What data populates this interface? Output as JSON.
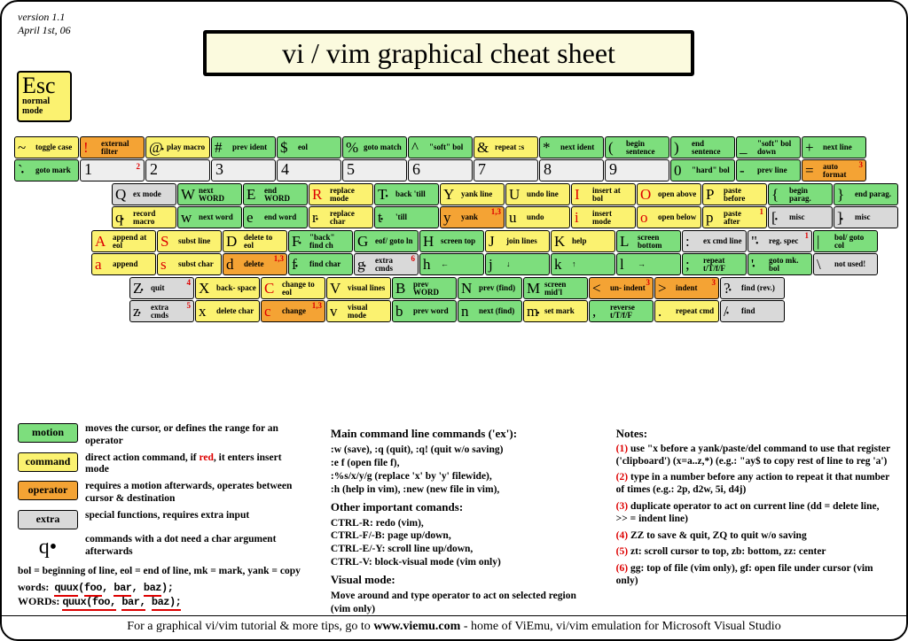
{
  "meta": {
    "version": "version 1.1",
    "date": "April 1st, 06"
  },
  "title": "vi / vim graphical cheat sheet",
  "esc": {
    "label": "Esc",
    "sub": "normal mode"
  },
  "rows": [
    [
      {
        "g": "~",
        "l": "toggle case",
        "c": "command"
      },
      {
        "g": "!",
        "l": "external filter",
        "c": "operator",
        "red": true
      },
      {
        "g": "@",
        "l": "play macro",
        "c": "command",
        "dot": true
      },
      {
        "g": "#",
        "l": "prev ident",
        "c": "motion"
      },
      {
        "g": "$",
        "l": "eol",
        "c": "motion"
      },
      {
        "g": "%",
        "l": "goto match",
        "c": "motion"
      },
      {
        "g": "^",
        "l": "\"soft\" bol",
        "c": "motion"
      },
      {
        "g": "&",
        "l": "repeat :s",
        "c": "command"
      },
      {
        "g": "*",
        "l": "next ident",
        "c": "motion"
      },
      {
        "g": "(",
        "l": "begin sentence",
        "c": "motion"
      },
      {
        "g": ")",
        "l": "end sentence",
        "c": "motion"
      },
      {
        "g": "_",
        "l": "\"soft\" bol down",
        "c": "motion"
      },
      {
        "g": "+",
        "l": "next line",
        "c": "motion"
      }
    ],
    [
      {
        "g": "`",
        "l": "goto mark",
        "c": "motion",
        "dot": true
      },
      {
        "g": "1",
        "c": "num",
        "sup": "2"
      },
      {
        "g": "2",
        "c": "num"
      },
      {
        "g": "3",
        "c": "num"
      },
      {
        "g": "4",
        "c": "num"
      },
      {
        "g": "5",
        "c": "num"
      },
      {
        "g": "6",
        "c": "num"
      },
      {
        "g": "7",
        "c": "num"
      },
      {
        "g": "8",
        "c": "num"
      },
      {
        "g": "9",
        "c": "num"
      },
      {
        "g": "0",
        "l": "\"hard\" bol",
        "c": "motion"
      },
      {
        "g": "-",
        "l": "prev line",
        "c": "motion"
      },
      {
        "g": "=",
        "l": "auto format",
        "c": "operator",
        "sup": "3"
      }
    ],
    [
      {
        "g": "Q",
        "l": "ex mode",
        "c": "extra"
      },
      {
        "g": "W",
        "l": "next WORD",
        "c": "motion"
      },
      {
        "g": "E",
        "l": "end WORD",
        "c": "motion"
      },
      {
        "g": "R",
        "l": "replace mode",
        "c": "command",
        "red": true
      },
      {
        "g": "T",
        "l": "back 'till",
        "c": "motion",
        "dot": true
      },
      {
        "g": "Y",
        "l": "yank line",
        "c": "command"
      },
      {
        "g": "U",
        "l": "undo line",
        "c": "command"
      },
      {
        "g": "I",
        "l": "insert at bol",
        "c": "command",
        "red": true
      },
      {
        "g": "O",
        "l": "open above",
        "c": "command",
        "red": true
      },
      {
        "g": "P",
        "l": "paste before",
        "c": "command"
      },
      {
        "g": "{",
        "l": "begin parag.",
        "c": "motion"
      },
      {
        "g": "}",
        "l": "end parag.",
        "c": "motion"
      }
    ],
    [
      {
        "g": "q",
        "l": "record macro",
        "c": "command",
        "dot": true
      },
      {
        "g": "w",
        "l": "next word",
        "c": "motion"
      },
      {
        "g": "e",
        "l": "end word",
        "c": "motion"
      },
      {
        "g": "r",
        "l": "replace char",
        "c": "command",
        "dot": true
      },
      {
        "g": "t",
        "l": "'till",
        "c": "motion",
        "dot": true
      },
      {
        "g": "y",
        "l": "yank",
        "c": "operator",
        "sup": "1,3"
      },
      {
        "g": "u",
        "l": "undo",
        "c": "command"
      },
      {
        "g": "i",
        "l": "insert mode",
        "c": "command",
        "red": true
      },
      {
        "g": "o",
        "l": "open below",
        "c": "command",
        "red": true
      },
      {
        "g": "p",
        "l": "paste after",
        "c": "command",
        "sup": "1"
      },
      {
        "g": "[",
        "l": "misc",
        "c": "extra",
        "dot": true
      },
      {
        "g": "]",
        "l": "misc",
        "c": "extra",
        "dot": true
      }
    ],
    [
      {
        "g": "A",
        "l": "append at eol",
        "c": "command",
        "red": true
      },
      {
        "g": "S",
        "l": "subst line",
        "c": "command",
        "red": true
      },
      {
        "g": "D",
        "l": "delete to eol",
        "c": "command"
      },
      {
        "g": "F",
        "l": "\"back\" find ch",
        "c": "motion",
        "dot": true
      },
      {
        "g": "G",
        "l": "eof/ goto ln",
        "c": "motion"
      },
      {
        "g": "H",
        "l": "screen top",
        "c": "motion"
      },
      {
        "g": "J",
        "l": "join lines",
        "c": "command"
      },
      {
        "g": "K",
        "l": "help",
        "c": "command"
      },
      {
        "g": "L",
        "l": "screen bottom",
        "c": "motion"
      },
      {
        "g": ":",
        "l": "ex cmd line",
        "c": "extra"
      },
      {
        "g": "\"",
        "l": "reg. spec",
        "c": "extra",
        "dot": true,
        "sup": "1"
      },
      {
        "g": "|",
        "l": "bol/ goto col",
        "c": "motion"
      }
    ],
    [
      {
        "g": "a",
        "l": "append",
        "c": "command",
        "red": true
      },
      {
        "g": "s",
        "l": "subst char",
        "c": "command",
        "red": true
      },
      {
        "g": "d",
        "l": "delete",
        "c": "operator",
        "sup": "1,3"
      },
      {
        "g": "f",
        "l": "find char",
        "c": "motion",
        "dot": true
      },
      {
        "g": "g",
        "l": "extra cmds",
        "c": "extra",
        "dot": true,
        "sup": "6"
      },
      {
        "g": "h",
        "l": "←",
        "c": "motion",
        "arr": true
      },
      {
        "g": "j",
        "l": "↓",
        "c": "motion",
        "arr": true
      },
      {
        "g": "k",
        "l": "↑",
        "c": "motion",
        "arr": true
      },
      {
        "g": "l",
        "l": "→",
        "c": "motion",
        "arr": true
      },
      {
        "g": ";",
        "l": "repeat t/T/f/F",
        "c": "motion"
      },
      {
        "g": "'",
        "l": "goto mk. bol",
        "c": "motion",
        "dot": true
      },
      {
        "g": "\\",
        "l": "not used!",
        "c": "extra"
      }
    ],
    [
      {
        "g": "Z",
        "l": "quit",
        "c": "extra",
        "dot": true,
        "sup": "4"
      },
      {
        "g": "X",
        "l": "back- space",
        "c": "command"
      },
      {
        "g": "C",
        "l": "change to eol",
        "c": "command",
        "red": true
      },
      {
        "g": "V",
        "l": "visual lines",
        "c": "command"
      },
      {
        "g": "B",
        "l": "prev WORD",
        "c": "motion"
      },
      {
        "g": "N",
        "l": "prev (find)",
        "c": "motion"
      },
      {
        "g": "M",
        "l": "screen mid'l",
        "c": "motion"
      },
      {
        "g": "<",
        "l": "un- indent",
        "c": "operator",
        "sup": "3"
      },
      {
        "g": ">",
        "l": "indent",
        "c": "operator",
        "sup": "3"
      },
      {
        "g": "?",
        "l": "find (rev.)",
        "c": "extra",
        "dot": true
      }
    ],
    [
      {
        "g": "z",
        "l": "extra cmds",
        "c": "extra",
        "dot": true,
        "sup": "5"
      },
      {
        "g": "x",
        "l": "delete char",
        "c": "command"
      },
      {
        "g": "c",
        "l": "change",
        "c": "operator",
        "red": true,
        "sup": "1,3"
      },
      {
        "g": "v",
        "l": "visual mode",
        "c": "command"
      },
      {
        "g": "b",
        "l": "prev word",
        "c": "motion"
      },
      {
        "g": "n",
        "l": "next (find)",
        "c": "motion"
      },
      {
        "g": "m",
        "l": "set mark",
        "c": "command",
        "dot": true
      },
      {
        "g": ",",
        "l": "reverse t/T/f/F",
        "c": "motion"
      },
      {
        "g": ".",
        "l": "repeat cmd",
        "c": "command"
      },
      {
        "g": "/",
        "l": "find",
        "c": "extra",
        "dot": true
      }
    ]
  ],
  "legend": [
    {
      "c": "motion",
      "name": "motion",
      "text": "moves the cursor, or defines the range for an operator"
    },
    {
      "c": "command",
      "name": "command",
      "text": "direct action command, if <red>, it enters insert mode"
    },
    {
      "c": "operator",
      "name": "operator",
      "text": "requires a motion afterwards, operates between cursor & destination"
    },
    {
      "c": "extra",
      "name": "extra",
      "text": "special functions, requires extra input"
    }
  ],
  "legend_q": "commands with a dot need a char argument afterwards",
  "abbrev": "bol = beginning of line, eol = end of line, mk = mark, yank = copy",
  "wordex": {
    "label1": "words:",
    "val1": "quux(foo, bar, baz);",
    "label2": "WORDs:",
    "val2": "quux(foo, bar, baz);"
  },
  "col2": {
    "h1": "Main command line commands ('ex'):",
    "l1": ":w (save), :q (quit), :q! (quit w/o saving)",
    "l2": ":e f (open file f),",
    "l3": ":%s/x/y/g (replace 'x' by 'y' filewide),",
    "l4": ":h (help in vim), :new (new file in vim),",
    "h2": "Other important comands:",
    "l5": "CTRL-R: redo (vim),",
    "l6": "CTRL-F/-B: page up/down,",
    "l7": "CTRL-E/-Y: scroll line up/down,",
    "l8": "CTRL-V: block-visual mode (vim only)",
    "h3": "Visual mode:",
    "l9": "Move around and type operator to act on selected region (vim only)"
  },
  "notes": {
    "title": "Notes:",
    "n1": "use \"x before a yank/paste/del command to use that register ('clipboard') (x=a..z,*) (e.g.: \"ay$ to copy rest of line to reg 'a')",
    "n2": "type in a number before any action to repeat it that number of times (e.g.: 2p, d2w, 5i, d4j)",
    "n3": "duplicate operator to act on current line (dd = delete line, >> = indent line)",
    "n4": "ZZ to save & quit, ZQ to quit w/o saving",
    "n5": "zt: scroll cursor to top, zb: bottom, zz: center",
    "n6": "gg: top of file (vim only), gf: open file under cursor (vim only)"
  },
  "footer": {
    "pre": "For a graphical vi/vim tutorial & more tips, go to ",
    "url": "  www.viemu.com  ",
    "post": " - home of ViEmu, vi/vim emulation for Microsoft Visual Studio"
  }
}
